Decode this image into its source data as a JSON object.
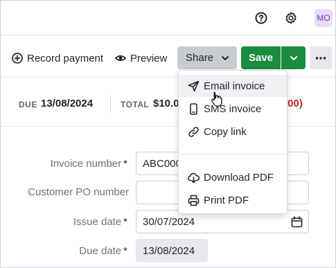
{
  "header": {
    "help_icon": "help-circle-icon",
    "settings_icon": "gear-icon",
    "avatar_initials": "MO"
  },
  "actions": {
    "record_payment_label": "Record payment",
    "preview_label": "Preview",
    "share_label": "Share",
    "save_label": "Save"
  },
  "summary": {
    "due_label": "DUE",
    "due_value": "13/08/2024",
    "total_label": "TOTAL",
    "total_value": "$10.0",
    "partial_red_value": ".00)"
  },
  "form": {
    "invoice_number_label": "Invoice number",
    "invoice_number_value": "ABC000",
    "customer_po_label": "Customer PO number",
    "customer_po_value": "",
    "issue_date_label": "Issue date",
    "issue_date_value": "30/07/2024",
    "due_date_label": "Due date",
    "due_date_value": "13/08/2024",
    "required_marker": "*"
  },
  "share_menu": {
    "items": [
      {
        "label": "Email invoice",
        "icon": "send-icon"
      },
      {
        "label": "SMS invoice",
        "icon": "phone-icon"
      },
      {
        "label": "Copy link",
        "icon": "link-icon"
      },
      {
        "label": "Download PDF",
        "icon": "cloud-download-icon"
      },
      {
        "label": "Print PDF",
        "icon": "printer-icon"
      }
    ],
    "hovered_index": 0
  },
  "colors": {
    "save_green": "#1a8c3e",
    "share_gray": "#c8ccd1",
    "overdue_red": "#c62828",
    "avatar_bg": "#eadcf7"
  }
}
